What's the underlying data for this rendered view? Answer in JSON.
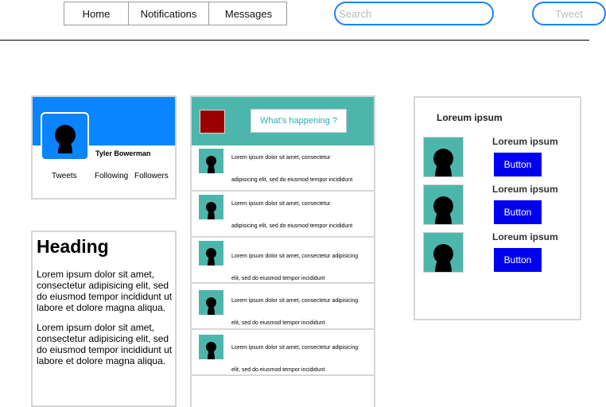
{
  "nav": {
    "items": [
      {
        "label": "Home"
      },
      {
        "label": "Notifications"
      },
      {
        "label": "Messages"
      }
    ]
  },
  "search": {
    "placeholder": "Search"
  },
  "tweet_button": {
    "label": "Tweet"
  },
  "profile": {
    "name": "Tyler Bowerman",
    "stats": {
      "tweets": "Tweets",
      "following": "Following",
      "followers": "Followers"
    },
    "colors": {
      "banner": "#0a84ff"
    }
  },
  "text_card": {
    "heading": "Heading",
    "paragraphs": [
      "Lorem ipsum dolor sit amet, consectetur adipisicing elit, sed do eiusmod tempor incididunt ut labore et dolore magna aliqua.",
      "Lorem ipsum dolor sit amet, consectetur adipisicing elit, sed do eiusmod tempor incididunt ut labore et dolore magna aliqua."
    ]
  },
  "feed": {
    "compose_placeholder": "What's happening ?",
    "colors": {
      "header": "#4db6ac",
      "compose_square": "#9b0000"
    },
    "items": [
      {
        "line1": "Lorem ipsum dolor sit amet, consectetur",
        "line2": "adipisicing elit, sed do eiusmod tempor incididunt"
      },
      {
        "line1": "Lorem ipsum dolor sit amet, consectetur",
        "line2": "adipisicing elit, sed do eiusmod tempor incididunt"
      },
      {
        "line1": "Lorem ipsum dolor sit amet, consectetur adipisicing",
        "line2": "elit, sed do eiusmod tempor incididunt"
      },
      {
        "line1": "Lorem ipsum dolor sit amet, consectetur adipisicing",
        "line2": "elit, sed do eiusmod tempor incididunt"
      },
      {
        "line1": "Lorem ipsum dolor sit amet, consectetur adipisicing",
        "line2": "elit, sed do eiusmod tempor incididunt"
      }
    ]
  },
  "suggestions": {
    "title": "Loreum ipsum",
    "items": [
      {
        "name": "Loreum ipsum",
        "button": "Button"
      },
      {
        "name": "Loreum ipsum",
        "button": "Button"
      },
      {
        "name": "Loreum ipsum",
        "button": "Button"
      }
    ],
    "colors": {
      "button": "#0000ee",
      "avatar": "#4db6ac"
    }
  }
}
